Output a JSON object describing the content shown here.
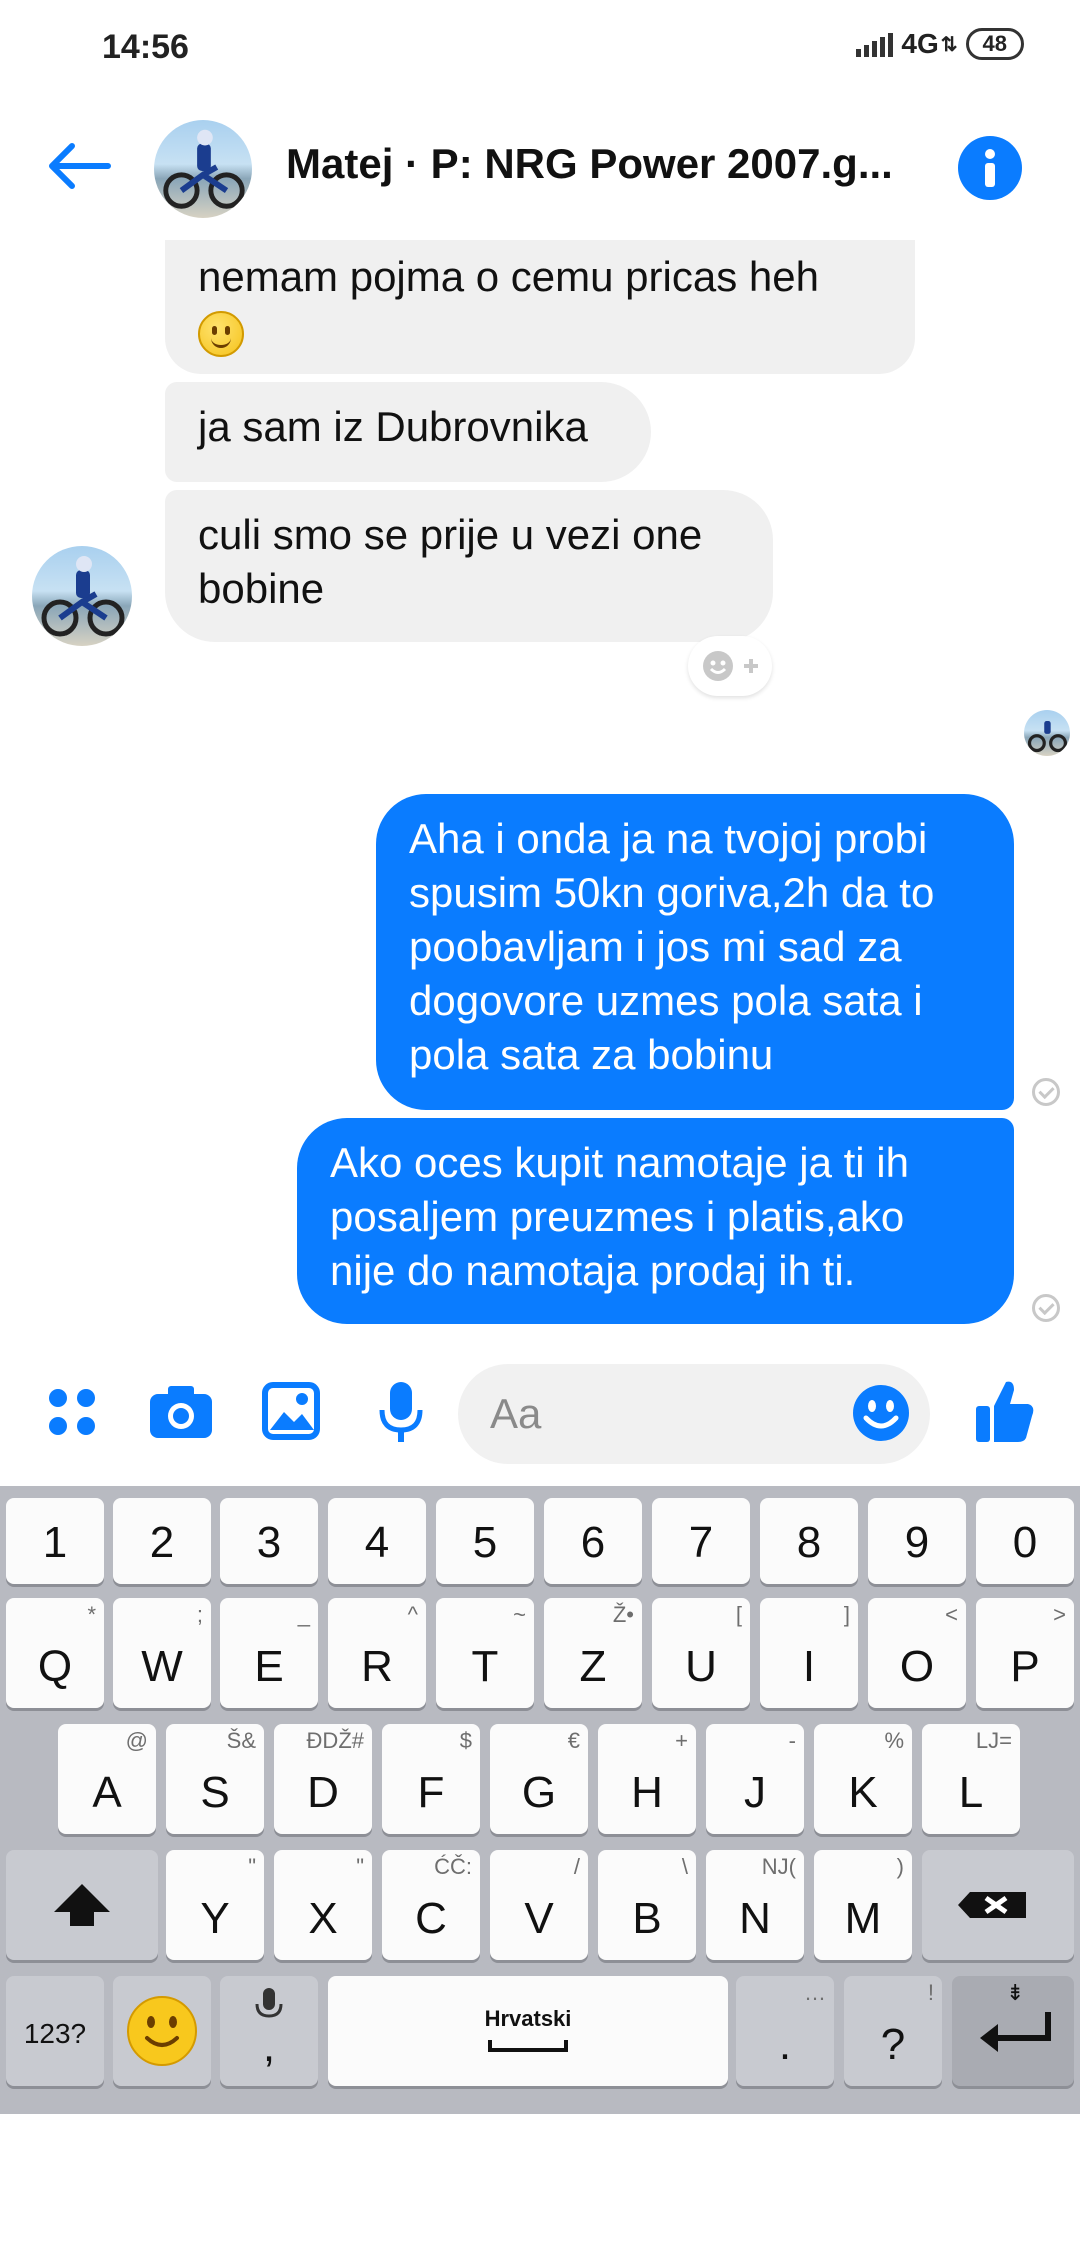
{
  "status_bar": {
    "time": "14:56",
    "network": "4G",
    "battery": "48"
  },
  "header": {
    "title": "Matej · P: NRG Power 2007.g...",
    "back_icon": "arrow-left-icon",
    "info_icon": "info-icon"
  },
  "messages": [
    {
      "dir": "in",
      "text": "nemam pojma o cemu pricas heh",
      "emoji": "slightly-smiling-face"
    },
    {
      "dir": "in",
      "text": "ja sam iz Dubrovnika"
    },
    {
      "dir": "in",
      "text": "culi smo se prije u vezi one bobine"
    },
    {
      "dir": "out",
      "text": "Aha i onda ja na tvojoj probi spusim 50kn goriva,2h da to poobavljam i jos mi sad za dogovore uzmes pola sata i pola sata za bobinu"
    },
    {
      "dir": "out",
      "text": "Ako oces kupit namotaje ja ti ih posaljem preuzmes i platis,ako nije do namotaja prodaj ih ti."
    }
  ],
  "composer": {
    "placeholder": "Aa",
    "icons": [
      "apps-icon",
      "camera-icon",
      "gallery-icon",
      "microphone-icon",
      "emoji-icon",
      "like-icon"
    ]
  },
  "colors": {
    "accent": "#0a7cff",
    "incoming_bubble": "#f0f0f0",
    "keyboard_bg": "#b8bac1"
  },
  "keyboard": {
    "row_numbers": [
      "1",
      "2",
      "3",
      "4",
      "5",
      "6",
      "7",
      "8",
      "9",
      "0"
    ],
    "row1": [
      [
        "Q",
        "*"
      ],
      [
        "W",
        ";"
      ],
      [
        "E",
        "_"
      ],
      [
        "R",
        "^"
      ],
      [
        "T",
        "~"
      ],
      [
        "Z",
        "Ž•"
      ],
      [
        "U",
        "["
      ],
      [
        "I",
        "]"
      ],
      [
        "O",
        "<"
      ],
      [
        "P",
        ">"
      ]
    ],
    "row2": [
      [
        "A",
        "@"
      ],
      [
        "S",
        "Š&"
      ],
      [
        "D",
        "ĐDŽ#"
      ],
      [
        "F",
        "$"
      ],
      [
        "G",
        "€"
      ],
      [
        "H",
        "+"
      ],
      [
        "J",
        "-"
      ],
      [
        "K",
        "%"
      ],
      [
        "L",
        "LJ="
      ]
    ],
    "row3": [
      [
        "Y",
        "\""
      ],
      [
        "X",
        "\""
      ],
      [
        "C",
        "ĆČ:"
      ],
      [
        "V",
        "/"
      ],
      [
        "B",
        "\\"
      ],
      [
        "N",
        "NJ("
      ],
      [
        "M",
        ")"
      ]
    ],
    "symbols_key": "123?",
    "mic_comma": ",",
    "space_label": "Hrvatski",
    "period": ".",
    "period_sub": "…",
    "question": "?",
    "question_sub": "!",
    "enter_sub": "⇟"
  }
}
